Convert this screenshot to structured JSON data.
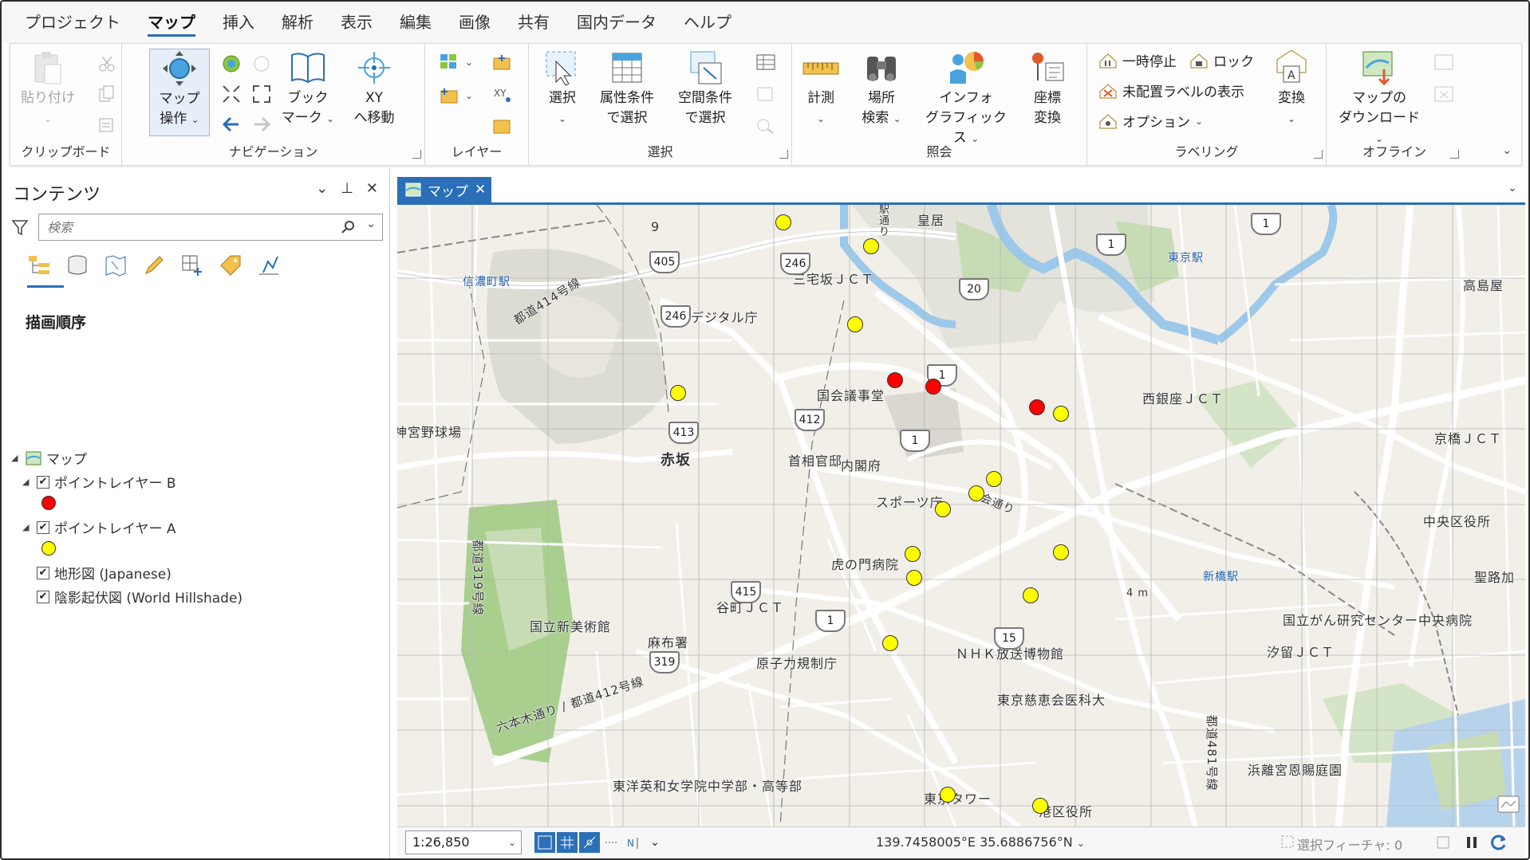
{
  "menu": {
    "tabs": [
      "プロジェクト",
      "マップ",
      "挿入",
      "解析",
      "表示",
      "編集",
      "画像",
      "共有",
      "国内データ",
      "ヘルプ"
    ],
    "active": "マップ"
  },
  "ribbon": {
    "clipboard": {
      "label": "クリップボード",
      "paste": "貼り付け"
    },
    "navigation": {
      "label": "ナビゲーション",
      "explore_1": "マップ",
      "explore_2": "操作",
      "bookmark_1": "ブック",
      "bookmark_2": "マーク",
      "goto_1": "XY",
      "goto_2": "へ移動"
    },
    "layer": {
      "label": "レイヤー"
    },
    "selection": {
      "label": "選択",
      "select": "選択",
      "by_attr_1": "属性条件",
      "by_attr_2": "で選択",
      "by_loc_1": "空間条件",
      "by_loc_2": "で選択"
    },
    "inquiry": {
      "label": "照会",
      "measure": "計測",
      "locate_1": "場所",
      "locate_2": "検索",
      "infographics_1": "インフォ",
      "infographics_2": "グラフィックス",
      "convert_1": "座標",
      "convert_2": "変換"
    },
    "labeling": {
      "label": "ラベリング",
      "pause": "一時停止",
      "lock": "ロック",
      "unplaced": "未配置ラベルの表示",
      "options": "オプション",
      "convert": "変換"
    },
    "offline": {
      "label": "オフライン",
      "download_1": "マップの",
      "download_2": "ダウンロード"
    }
  },
  "contents": {
    "title": "コンテンツ",
    "search_placeholder": "検索",
    "draw_order": "描画順序",
    "map": "マップ",
    "layer_b": "ポイントレイヤー B",
    "layer_a": "ポイントレイヤー A",
    "basemap": "地形図 (Japanese)",
    "hillshade": "陰影起伏図 (World Hillshade)"
  },
  "map_tab": {
    "label": "マップ"
  },
  "map_labels": {
    "kokyo": "皇居",
    "station_hint": "駅\n通\nり",
    "num9": "9",
    "shinanomachi": "信濃町駅",
    "toei": "都道414号線",
    "miyakezaka": "三宅坂ＪＣＴ",
    "digital": "デジタル庁",
    "tokyo_sta": "東京駅",
    "takashimaya": "高島屋",
    "kokkai": "国会議事堂",
    "nishiginza": "西銀座ＪＣＴ",
    "jingu": "神宮野球場",
    "akasaka": "赤坂",
    "shusho": "首相官邸",
    "naikaku": "内閣府",
    "kyobashi": "京橋ＪＣＴ",
    "sports": "スポーツ庁",
    "kokkai_dori": "国会通り",
    "chuoku": "中央区役所",
    "toranomon": "虎の門病院",
    "shinbashi": "新橋駅",
    "seiroka": "聖路加",
    "tanimachi": "谷町ＪＣＴ",
    "nact": "国立新美術館",
    "ncc": "国立がん研究センター中央病院",
    "azabu": "麻布署",
    "nhk": "ＮＨＫ放送博物館",
    "shiodome": "汐留ＪＣＴ",
    "nra": "原子力規制庁",
    "jikei": "東京慈恵会医科大",
    "toei412": "六本木通り / 都道412号線",
    "hamarikyu": "浜離宮恩賜庭園",
    "toyoeiwa": "東洋英和女学院中学部・高等部",
    "tower": "東京タワー",
    "minato": "港区役所",
    "toei319": "都道319号線",
    "toei481": "都道481号線",
    "dist": "4 m"
  },
  "shields": [
    "405",
    "246",
    "246",
    "20",
    "1",
    "1",
    "1",
    "1",
    "412",
    "413",
    "415",
    "1",
    "15",
    "319"
  ],
  "colors": {
    "accent": "#2a6fb8",
    "layer_a": "#ffff00",
    "layer_b": "#ff0000"
  },
  "status": {
    "scale": "1:26,850",
    "coords": "139.7458005°E 35.6886756°N",
    "selected": "選択フィーチャ: 0"
  }
}
